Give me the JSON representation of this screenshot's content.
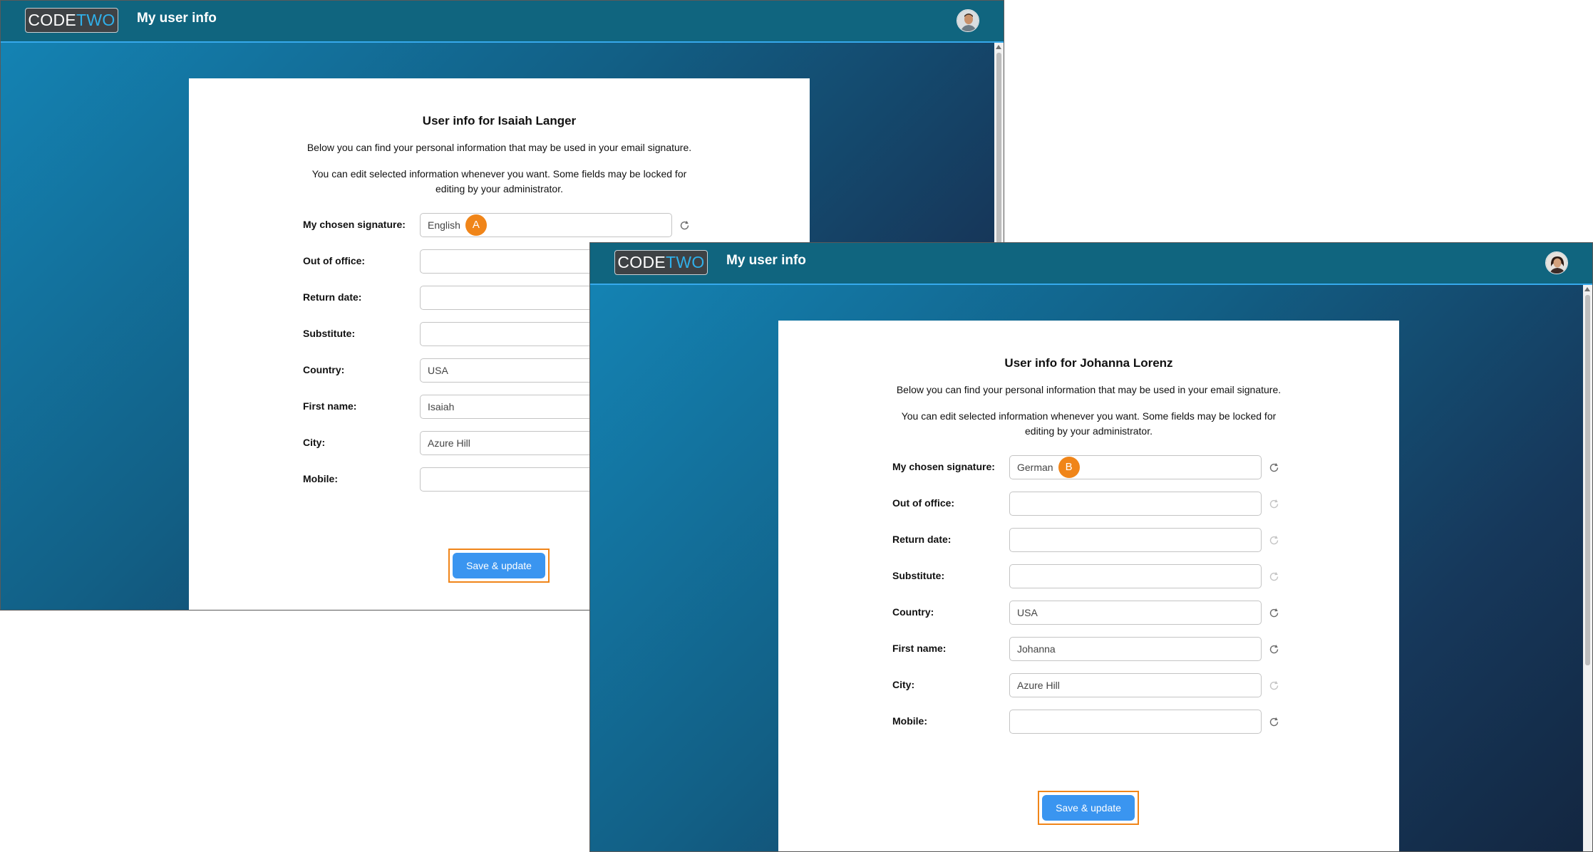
{
  "logo": {
    "code": "CODE",
    "two": "TWO"
  },
  "app_title": "My user info",
  "windows": [
    {
      "title": "User info for Isaiah Langer",
      "intro": "Below you can find your personal information that may be used in your email signature.",
      "note": "You can edit selected information whenever you want. Some fields may be locked for editing by your administrator.",
      "badge": "A",
      "fields": [
        {
          "label": "My chosen signature:",
          "value": "English"
        },
        {
          "label": "Out of office:",
          "value": ""
        },
        {
          "label": "Return date:",
          "value": ""
        },
        {
          "label": "Substitute:",
          "value": ""
        },
        {
          "label": "Country:",
          "value": "USA"
        },
        {
          "label": "First name:",
          "value": "Isaiah"
        },
        {
          "label": "City:",
          "value": "Azure Hill"
        },
        {
          "label": "Mobile:",
          "value": ""
        }
      ],
      "save_label": "Save & update"
    },
    {
      "title": "User info for Johanna Lorenz",
      "intro": "Below you can find your personal information that may be used in your email signature.",
      "note": "You can edit selected information whenever you want. Some fields may be locked for editing by your administrator.",
      "badge": "B",
      "fields": [
        {
          "label": "My chosen signature:",
          "value": "German"
        },
        {
          "label": "Out of office:",
          "value": ""
        },
        {
          "label": "Return date:",
          "value": ""
        },
        {
          "label": "Substitute:",
          "value": ""
        },
        {
          "label": "Country:",
          "value": "USA"
        },
        {
          "label": "First name:",
          "value": "Johanna"
        },
        {
          "label": "City:",
          "value": "Azure Hill"
        },
        {
          "label": "Mobile:",
          "value": ""
        }
      ],
      "save_label": "Save & update"
    }
  ],
  "colors": {
    "header": "#10657f",
    "header_accent": "#36a9ec",
    "button": "#3a95f0",
    "highlight": "#f08519"
  }
}
